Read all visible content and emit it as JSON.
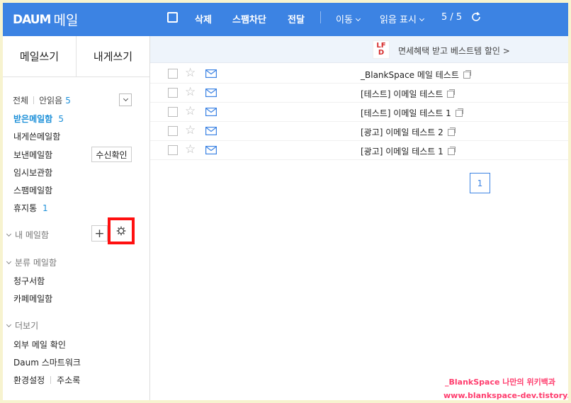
{
  "header": {
    "logo_text": "DAUM",
    "service_name": "메일",
    "toolbar": {
      "delete": "삭제",
      "block_spam": "스팸차단",
      "forward": "전달",
      "move": "이동",
      "mark_read": "읽음 표시",
      "page_counter": "5 / 5"
    }
  },
  "sidebar": {
    "compose": "메일쓰기",
    "write_to_me": "내게쓰기",
    "filter_all": "전체",
    "filter_unread": "안읽음",
    "filter_unread_count": "5",
    "folders": {
      "inbox": "받은메일함",
      "inbox_count": "5",
      "sent_to_me": "내게쓴메일함",
      "sent": "보낸메일함",
      "read_receipt": "수신확인",
      "drafts": "임시보관함",
      "spam": "스팸메일함",
      "trash": "휴지통",
      "trash_count": "1"
    },
    "my_mailbox_section": "내 메일함",
    "category_section": "분류 메일함",
    "categories": [
      "청구서함",
      "카페메일함"
    ],
    "more_section": "더보기",
    "more_items": {
      "external": "외부 메일 확인",
      "smartwork": "Daum 스마트워크",
      "settings": "환경설정",
      "addressbook": "주소록"
    }
  },
  "banner": {
    "logo_lines": [
      "LF",
      "D"
    ],
    "text": "면세혜택 받고 베스트템 할인 >"
  },
  "emails": [
    {
      "subject": "_BlankSpace 메일 테스트"
    },
    {
      "subject": "[테스트] 이메일 테스트"
    },
    {
      "subject": "[테스트] 이메일 테스트 1"
    },
    {
      "subject": "[광고] 이메일 테스트 2"
    },
    {
      "subject": "[광고] 이메일 테스트 1"
    }
  ],
  "pagination": {
    "current": "1"
  },
  "watermark": {
    "line1": "_BlankSpace 나만의 위키백과",
    "line2": "www.blankspace-dev.tistory.com"
  },
  "colors": {
    "header_bg": "#3c83e3",
    "accent": "#1b8fd8",
    "highlight": "#ff1010"
  }
}
